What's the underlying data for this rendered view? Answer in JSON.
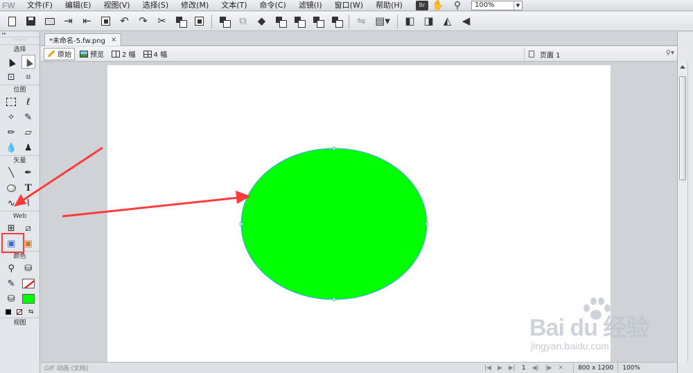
{
  "app": {
    "logo": "FW",
    "menus": [
      "文件(F)",
      "编辑(E)",
      "视图(V)",
      "选择(S)",
      "修改(M)",
      "文本(T)",
      "命令(C)",
      "滤镜(I)",
      "窗口(W)",
      "帮助(H)"
    ],
    "bridge_label": "Br",
    "zoom_value": "100%"
  },
  "tools": {
    "sections": {
      "select": "选择",
      "bitmap": "位图",
      "vector": "矢量",
      "web": "Web",
      "colors": "颜色",
      "view": "视图"
    },
    "stroke_color": "#ff0000",
    "fill_color": "#00ff00",
    "active_tool": "ellipse-tool"
  },
  "document": {
    "tab_title": "*未命名-5.fw.png",
    "tab_close": "×",
    "views": {
      "original": "原始",
      "preview": "预览",
      "two_up": "2 幅",
      "four_up": "4 幅"
    },
    "page_label": "页面 1",
    "canvas": {
      "background": "#ffffff",
      "shape": "ellipse",
      "shape_fill": "#00ff00",
      "shape_stroke": "#3ea0ff"
    }
  },
  "statusbar": {
    "left_text": "GIF 动画 (文档)",
    "frame": "1",
    "canvas_size": "800 x 1200",
    "zoom": "100%"
  },
  "annotation": {
    "color": "#ff3b3b"
  },
  "watermark": {
    "main": "Bai  du 经验",
    "sub": "jingyan.baidu.com"
  }
}
